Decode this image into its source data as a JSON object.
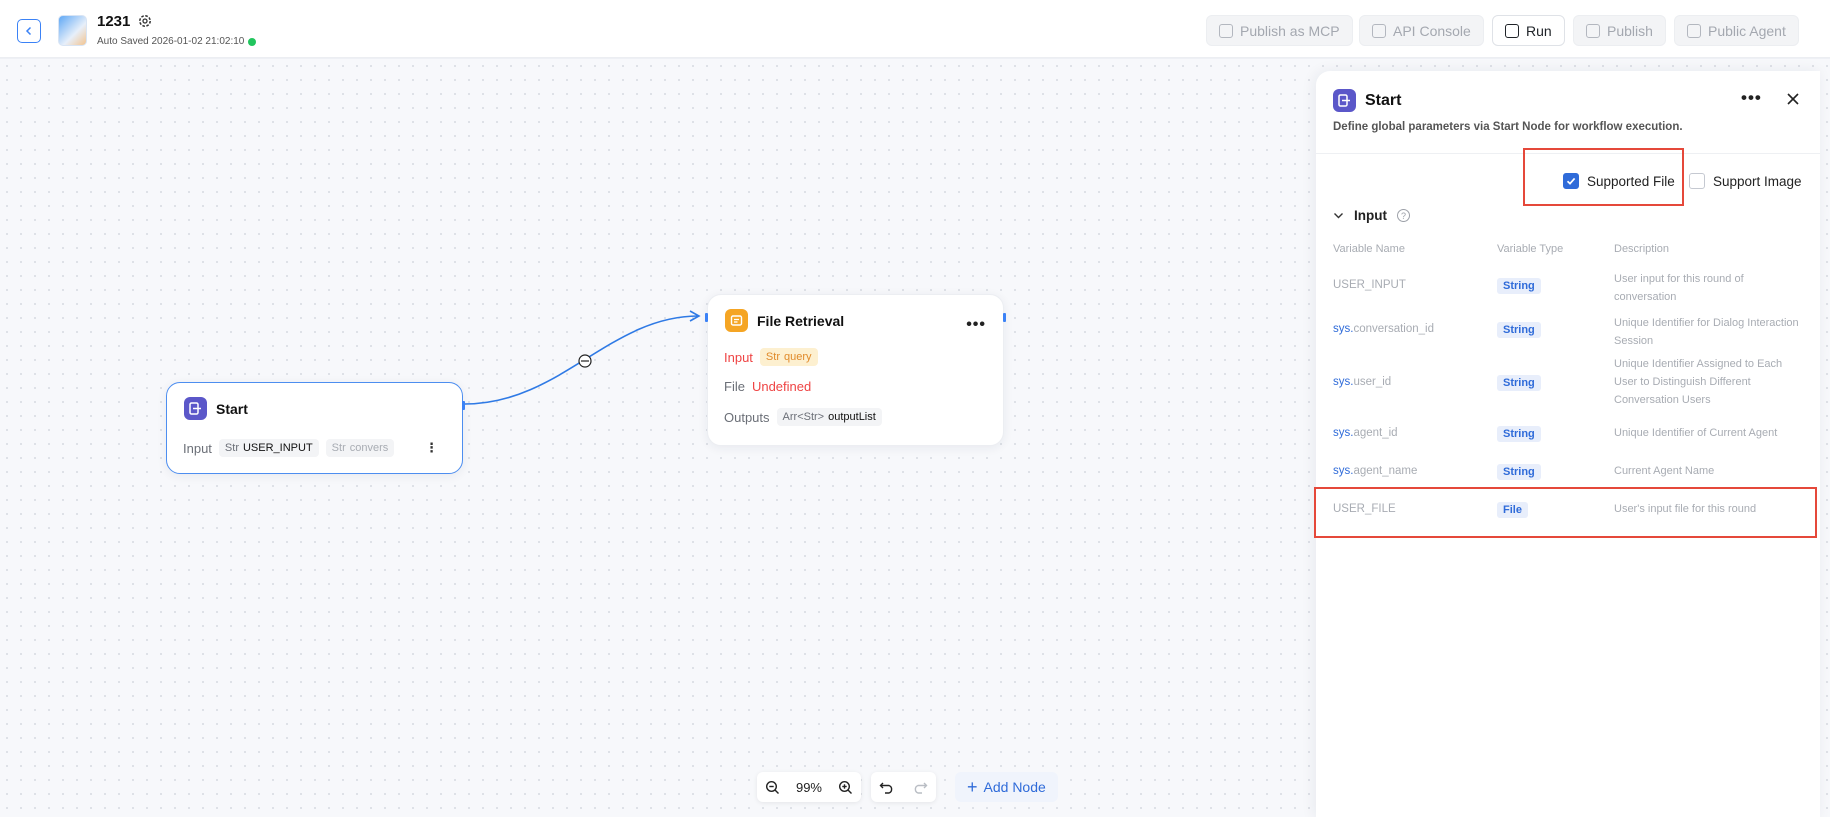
{
  "header": {
    "title": "1231",
    "autosave": "Auto Saved 2026-01-02 21:02:10",
    "buttons": {
      "publish_mcp": "Publish as MCP",
      "api_console": "API Console",
      "run": "Run",
      "publish": "Publish",
      "public_agent": "Public Agent"
    }
  },
  "nodes": {
    "start": {
      "title": "Start",
      "input_label": "Input",
      "chip1_type": "Str",
      "chip1_name": "USER_INPUT",
      "chip2_type": "Str",
      "chip2_name": "convers"
    },
    "file_retrieval": {
      "title": "File Retrieval",
      "input_label": "Input",
      "input_type": "Str",
      "input_name": "query",
      "file_label": "File",
      "file_value": "Undefined",
      "outputs_label": "Outputs",
      "outputs_type": "Arr<Str>",
      "outputs_name": "outputList"
    }
  },
  "toolbar": {
    "zoom": "99%",
    "add_node": "Add Node"
  },
  "panel": {
    "title": "Start",
    "description": "Define global parameters via Start Node for workflow execution.",
    "supported_file": "Supported File",
    "support_image": "Support Image",
    "supported_file_checked": true,
    "support_image_checked": false,
    "section": "Input",
    "columns": {
      "name": "Variable Name",
      "type": "Variable Type",
      "desc": "Description"
    },
    "rows": [
      {
        "prefix": "",
        "name": "USER_INPUT",
        "type": "String",
        "desc": "User input for this round of conversation"
      },
      {
        "prefix": "sys.",
        "name": "conversation_id",
        "type": "String",
        "desc": "Unique Identifier for Dialog Interaction Session"
      },
      {
        "prefix": "sys.",
        "name": "user_id",
        "type": "String",
        "desc": "Unique Identifier Assigned to Each User to Distinguish Different Conversation Users"
      },
      {
        "prefix": "sys.",
        "name": "agent_id",
        "type": "String",
        "desc": "Unique Identifier of Current Agent"
      },
      {
        "prefix": "sys.",
        "name": "agent_name",
        "type": "String",
        "desc": "Current Agent Name"
      },
      {
        "prefix": "",
        "name": "USER_FILE",
        "type": "File",
        "desc": "User's input file for this round"
      }
    ]
  },
  "colors": {
    "accent": "#2f6bd9",
    "highlight": "#e5483a",
    "node_border": "#4d8ef0",
    "start_icon": "#5b57c9",
    "file_icon": "#f5a524"
  }
}
